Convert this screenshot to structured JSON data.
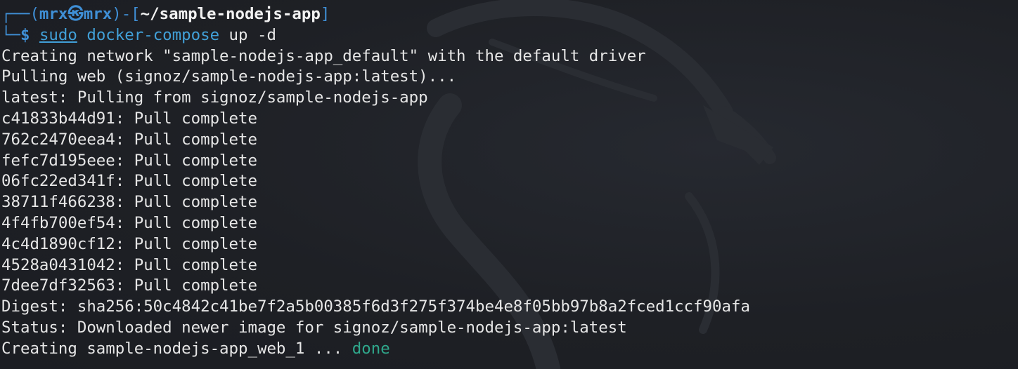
{
  "prompt": {
    "corner_top": "┌──(",
    "user": "mrx",
    "skull": "㉿",
    "host": "mrx",
    "sep": ")-[",
    "cwd": "~/sample-nodejs-app",
    "close": "]",
    "corner_bottom": "└─",
    "dollar": "$"
  },
  "command": {
    "sudo": "sudo",
    "program": "docker-compose",
    "args": " up -d"
  },
  "output": [
    "Creating network \"sample-nodejs-app_default\" with the default driver",
    "Pulling web (signoz/sample-nodejs-app:latest)...",
    "latest: Pulling from signoz/sample-nodejs-app",
    "c41833b44d91: Pull complete",
    "762c2470eea4: Pull complete",
    "fefc7d195eee: Pull complete",
    "06fc22ed341f: Pull complete",
    "38711f466238: Pull complete",
    "4f4fb700ef54: Pull complete",
    "4c4d1890cf12: Pull complete",
    "4528a0431042: Pull complete",
    "7dee7df32563: Pull complete",
    "Digest: sha256:50c4842c41be7f2a5b00385f6d3f275f374be4e8f05bb97b8a2fced1ccf90afa",
    "Status: Downloaded newer image for signoz/sample-nodejs-app:latest"
  ],
  "last_line": {
    "text": "Creating sample-nodejs-app_web_1 ... ",
    "status": "done"
  },
  "colors": {
    "background": "#1f2126",
    "prompt_blue": "#3f8fd6",
    "command_blue": "#41a0d8",
    "done_green": "#2fa88c",
    "text": "#e6e6e6"
  }
}
